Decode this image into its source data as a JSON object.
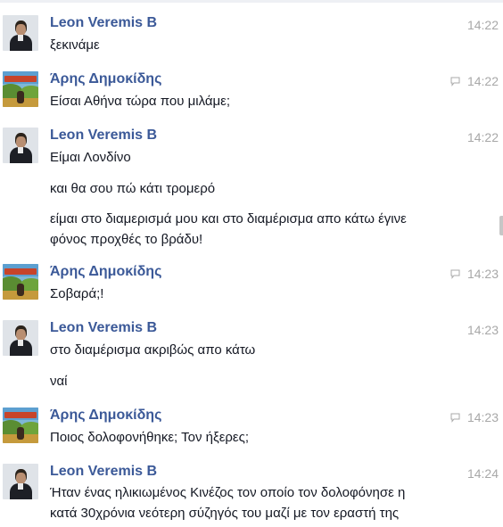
{
  "messages": [
    {
      "sender": "Leon Veremis B",
      "time": "14:22",
      "lines": [
        "ξεκινάμε"
      ]
    },
    {
      "sender": "Άρης Δημοκίδης",
      "time": "14:22",
      "seen_icon": "chat-bubble-icon",
      "lines": [
        "Είσαι Αθήνα τώρα που μιλάμε;"
      ]
    },
    {
      "sender": "Leon Veremis B",
      "time": "14:22",
      "lines": [
        "Είμαι Λονδίνο",
        "και θα σου πώ κάτι τρομερό",
        "είμαι στο διαμερισμά μου και στο διαμέρισμα απο κάτω έγινε φόνος προχθές το βράδυ!"
      ]
    },
    {
      "sender": "Άρης Δημοκίδης",
      "time": "14:23",
      "seen_icon": "chat-bubble-icon",
      "lines": [
        "Σοβαρά;!"
      ]
    },
    {
      "sender": "Leon Veremis B",
      "time": "14:23",
      "lines": [
        "στο διαμέρισμα ακριβώς απο κάτω",
        "ναί"
      ]
    },
    {
      "sender": "Άρης Δημοκίδης",
      "time": "14:23",
      "seen_icon": "chat-bubble-icon",
      "lines": [
        "Ποιος δολοφονήθηκε; Τον ήξερες;"
      ]
    },
    {
      "sender": "Leon Veremis B",
      "time": "14:24",
      "lines": [
        "Ήταν ένας ηλικιωμένος Κινέζος τον οποίο τον δολοφόνησε η κατά 30χρόνια νεότερη σύζηγός του μαζί με τον εραστή της"
      ]
    }
  ],
  "colors": {
    "name": "#3b5998",
    "text": "#141823",
    "time": "#a8a8a8"
  }
}
